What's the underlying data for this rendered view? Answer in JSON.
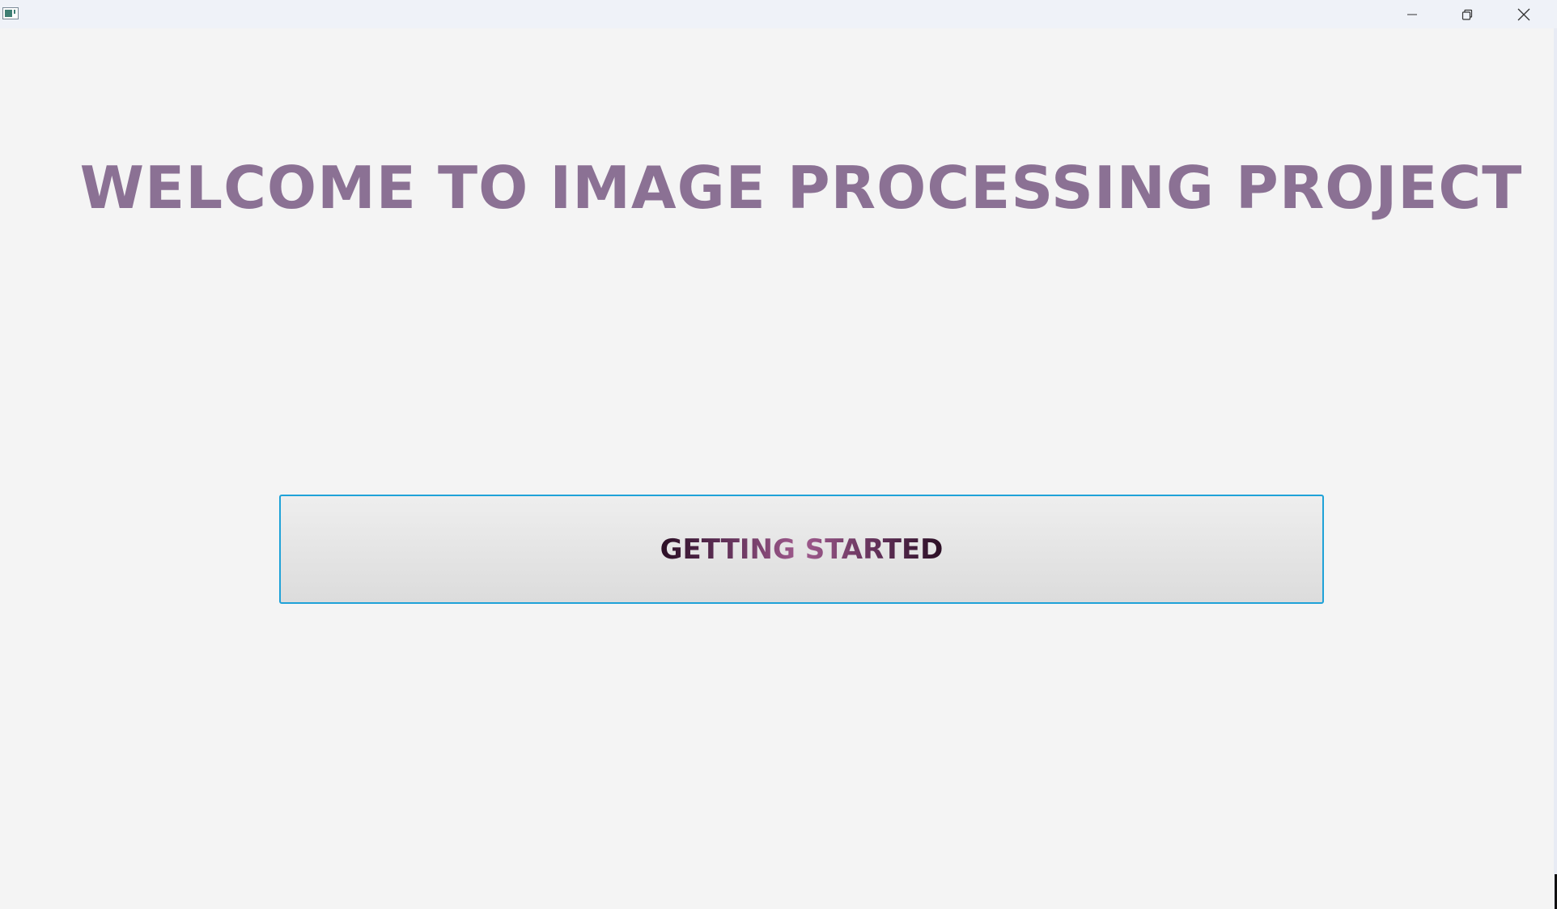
{
  "window": {
    "icon": "app-window-icon",
    "controls": {
      "minimize_icon": "minimize-icon",
      "maximize_icon": "restore-icon",
      "close_icon": "close-icon"
    }
  },
  "main": {
    "title": "WELCOME TO IMAGE PROCESSING PROJECT",
    "start_button_label": "GETTING STARTED"
  },
  "colors": {
    "title": "#8b7194",
    "button_border": "#1fa2d8",
    "background": "#f4f4f4",
    "titlebar": "#eff2f8"
  }
}
